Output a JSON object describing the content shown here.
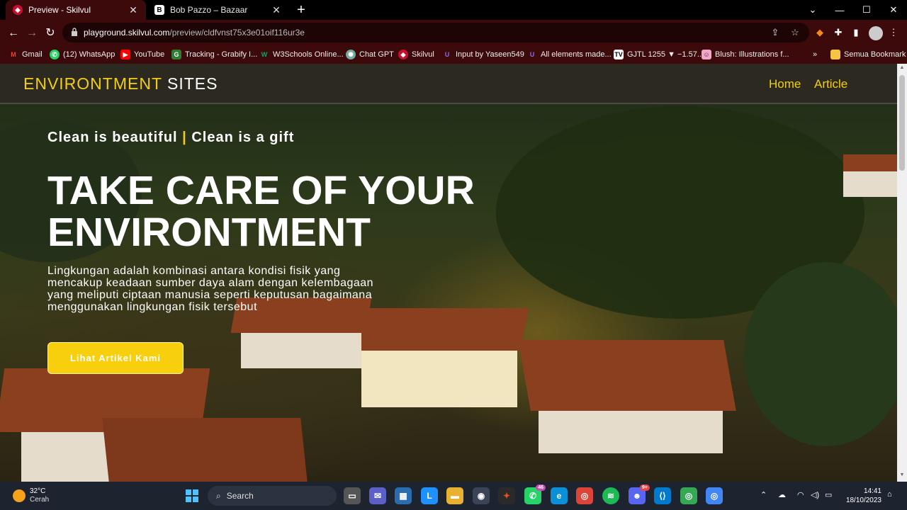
{
  "browser": {
    "tabs": [
      {
        "title": "Preview - Skilvul",
        "active": true
      },
      {
        "title": "Bob Pazzo – Bazaar",
        "active": false
      }
    ],
    "url_host": "playground.skilvul.com",
    "url_path": "/preview/cldfvnst75x3e01oif116ur3e",
    "bookmarks": [
      {
        "label": "Gmail",
        "icon": "gmail-icon"
      },
      {
        "label": "(12) WhatsApp",
        "icon": "whatsapp-icon"
      },
      {
        "label": "YouTube",
        "icon": "youtube-icon"
      },
      {
        "label": "Tracking - Grabify I...",
        "icon": "grabify-icon"
      },
      {
        "label": "W3Schools Online...",
        "icon": "w3schools-icon"
      },
      {
        "label": "Chat GPT",
        "icon": "chatgpt-icon"
      },
      {
        "label": "Skilvul",
        "icon": "skilvul-icon"
      },
      {
        "label": "Input by Yaseen549",
        "icon": "u-icon"
      },
      {
        "label": "All elements made...",
        "icon": "u-icon"
      },
      {
        "label": "GJTL 1255 ▼ −1.57...",
        "icon": "tradingview-icon"
      },
      {
        "label": "Blush: Illustrations f...",
        "icon": "blush-icon"
      }
    ],
    "bookmarks_overflow": "»",
    "all_bookmarks": "Semua Bookmark"
  },
  "site": {
    "brand_highlight": "ENVIRONTMENT",
    "brand_rest": "SITES",
    "nav": [
      "Home",
      "Article"
    ],
    "tagline_left": "Clean is beautiful",
    "tagline_sep": "|",
    "tagline_right": "Clean is a gift",
    "headline_line1": "TAKE CARE OF YOUR",
    "headline_line2": "ENVIRONTMENT",
    "description": "Lingkungan adalah kombinasi antara kondisi fisik yang mencakup keadaan sumber daya alam dengan kelembagaan yang meliputi ciptaan manusia seperti keputusan bagaimana menggunakan lingkungan fisik tersebut",
    "cta": "Lihat Artikel Kami"
  },
  "taskbar": {
    "temperature": "32°C",
    "weather": "Cerah",
    "search": "Search",
    "whatsapp_badge": "46",
    "discord_badge": "9+",
    "time": "14:41",
    "date": "18/10/2023"
  },
  "colors": {
    "accent": "#f2cd13",
    "button": "#f8cf0c",
    "header_bg": "#2c2a20",
    "browser_frame": "#3c0a0a"
  }
}
